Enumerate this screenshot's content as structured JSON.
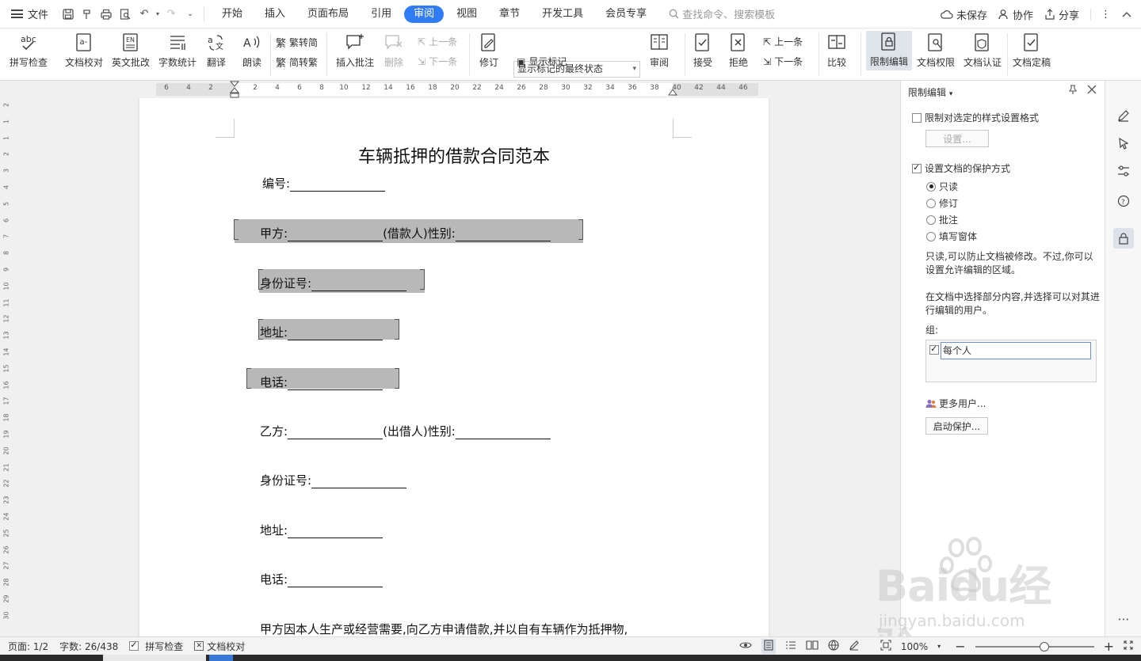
{
  "menubar": {
    "file_label": "文件",
    "tabs": [
      "开始",
      "插入",
      "页面布局",
      "引用",
      "审阅",
      "视图",
      "章节",
      "开发工具",
      "会员专享"
    ],
    "active_tab": "审阅",
    "search_placeholder": "查找命令、搜索模板",
    "unsaved": "未保存",
    "collab": "协作",
    "share": "分享"
  },
  "ribbon": {
    "spell_check": "拼写检查",
    "doc_proof": "文档校对",
    "eng_correct": "英文批改",
    "word_count": "字数统计",
    "translate": "翻译",
    "read_aloud": "朗读",
    "trad_to_simp": "繁转简",
    "simp_to_trad": "简转繁",
    "insert_comment": "插入批注",
    "delete": "删除",
    "prev_item": "上一条",
    "next_item": "下一条",
    "track_changes": "修订",
    "markup_state": "显示标记的最终状态",
    "show_markup": "显示标记",
    "review": "审阅",
    "accept": "接受",
    "reject": "拒绝",
    "prev_change": "上一条",
    "next_change": "下一条",
    "compare": "比较",
    "restrict_edit": "限制编辑",
    "doc_permission": "文档权限",
    "doc_cert": "文档认证",
    "doc_finalize": "文档定稿"
  },
  "ruler": {
    "h": [
      "6",
      "4",
      "2",
      "2",
      "4",
      "6",
      "8",
      "10",
      "12",
      "14",
      "16",
      "18",
      "20",
      "22",
      "24",
      "26",
      "28",
      "30",
      "32",
      "34",
      "36",
      "38",
      "40",
      "42",
      "44",
      "46"
    ],
    "v": [
      "2",
      "1",
      "1",
      "2",
      "3",
      "4",
      "5",
      "6",
      "7",
      "8",
      "9",
      "10",
      "11",
      "12",
      "13",
      "14",
      "15",
      "16",
      "17",
      "18",
      "19",
      "20",
      "21",
      "22",
      "23",
      "24",
      "25",
      "26",
      "27",
      "28",
      "29",
      "30"
    ]
  },
  "document": {
    "title": "车辆抵押的借款合同范本",
    "number_label": "编号:",
    "party_a": "甲方:",
    "borrower": "(借款人)",
    "gender": "性别:",
    "id_number": "身份证号:",
    "address": "地址:",
    "phone": "电话:",
    "party_b": "乙方:",
    "lender": "(出借人)",
    "body_line": "甲方因本人生产或经营需要,向乙方申请借款,并以自有车辆作为抵押物,"
  },
  "panel": {
    "title": "限制编辑",
    "limit_format": "限制对选定的样式设置格式",
    "settings_btn": "设置...",
    "set_protection": "设置文档的保护方式",
    "options": [
      "只读",
      "修订",
      "批注",
      "填写窗体"
    ],
    "selected_option": "只读",
    "desc1": "只读,可以防止文档被修改。不过,你可以设置允许编辑的区域。",
    "desc2": "在文档中选择部分内容,并选择可以对其进行编辑的用户。",
    "group_label": "组:",
    "group_everyone": "每个人",
    "more_users": "更多用户...",
    "start_protect": "启动保护..."
  },
  "status": {
    "page": "页面: 1/2",
    "words": "字数: 26/438",
    "spell": "拼写检查",
    "proof": "文档校对",
    "zoom": "100%",
    "zoom_level": 0.58
  },
  "watermark": {
    "brand": "Baidu经验",
    "url": "jingyan.baidu.com"
  }
}
